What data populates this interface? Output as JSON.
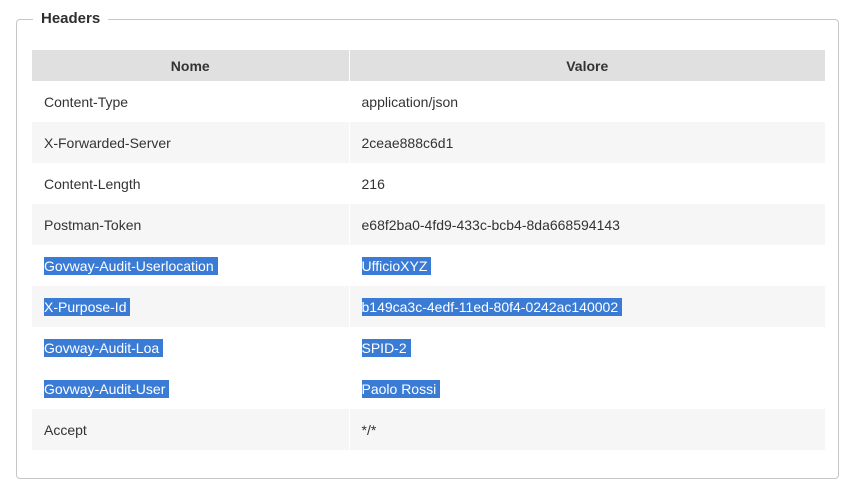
{
  "panel": {
    "title": "Headers"
  },
  "table": {
    "columns": [
      "Nome",
      "Valore"
    ],
    "rows": [
      {
        "name": "Content-Type",
        "value": "application/json",
        "selected": false
      },
      {
        "name": "X-Forwarded-Server",
        "value": "2ceae888c6d1",
        "selected": false
      },
      {
        "name": "Content-Length",
        "value": "216",
        "selected": false
      },
      {
        "name": "Postman-Token",
        "value": "e68f2ba0-4fd9-433c-bcb4-8da668594143",
        "selected": false
      },
      {
        "name": "Govway-Audit-Userlocation",
        "value": "UfficioXYZ",
        "selected": true
      },
      {
        "name": "X-Purpose-Id",
        "value": "b149ca3c-4edf-11ed-80f4-0242ac140002",
        "selected": true
      },
      {
        "name": "Govway-Audit-Loa",
        "value": "SPID-2",
        "selected": true
      },
      {
        "name": "Govway-Audit-User",
        "value": "Paolo Rossi",
        "selected": true
      },
      {
        "name": "Accept",
        "value": "*/*",
        "selected": false
      }
    ]
  },
  "colors": {
    "header_bg": "#e0e0e0",
    "stripe_bg": "#f6f6f6",
    "selection_bg": "#3a7bd5",
    "border": "#c6c6c6"
  }
}
